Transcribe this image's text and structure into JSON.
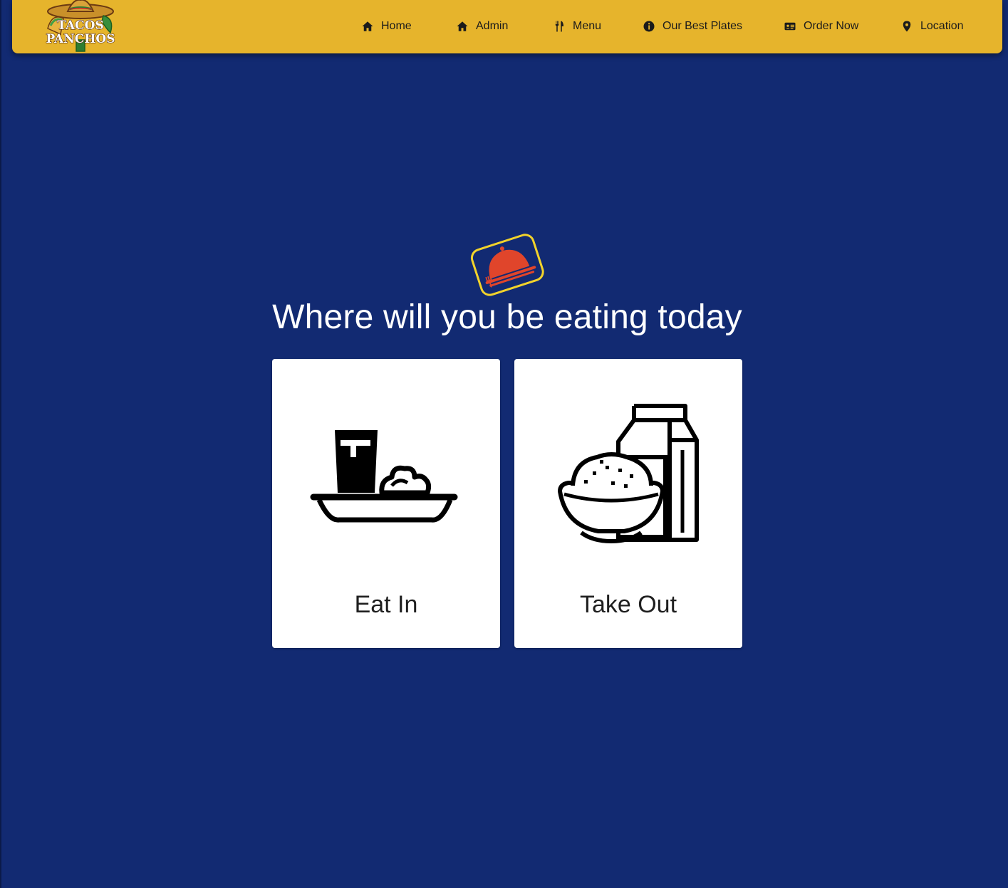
{
  "brand": {
    "logo_line1": "TACOS",
    "logo_line2": "PANCHOS"
  },
  "nav": {
    "items": [
      {
        "label": "Home",
        "icon": "home-icon"
      },
      {
        "label": "Admin",
        "icon": "home-icon"
      },
      {
        "label": "Menu",
        "icon": "utensils-icon"
      },
      {
        "label": "Our Best Plates",
        "icon": "info-icon"
      },
      {
        "label": "Order Now",
        "icon": "id-card-icon"
      },
      {
        "label": "Location",
        "icon": "map-pin-icon"
      }
    ]
  },
  "main": {
    "badge_icon": "cloche-icon",
    "headline": "Where will you be eating today",
    "options": [
      {
        "label": "Eat In",
        "icon": "tray-meal-icon"
      },
      {
        "label": "Take Out",
        "icon": "takeout-bowl-carton-icon"
      }
    ]
  },
  "colors": {
    "background": "#122a72",
    "navbar": "#e6b42c",
    "card": "#ffffff",
    "accent_red": "#e0452b",
    "accent_yellow": "#f2d32b"
  }
}
